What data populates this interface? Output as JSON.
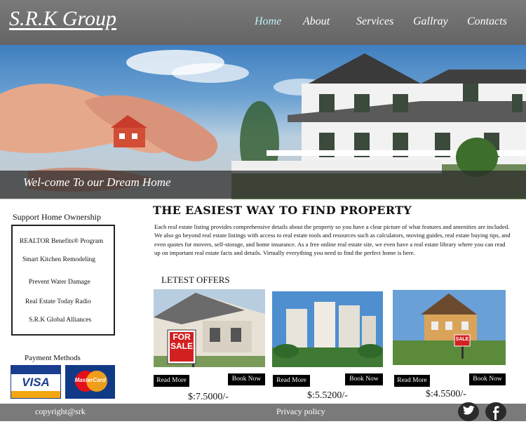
{
  "header": {
    "logo": "S.R.K Group",
    "nav": [
      "Home",
      "About",
      "Services",
      "Gallray",
      "Contacts"
    ],
    "active_index": 0
  },
  "hero": {
    "welcome": "Wel-come To our Dream Home"
  },
  "sidebar": {
    "title": "Support Home Ownership",
    "items": [
      "REALTOR Benefits® Program",
      "Smart Kitchen Remodeling",
      "Prevent Water Damage",
      "Real Estate Today Radio",
      "S.R.K Global Alliances"
    ],
    "payment_title": "Payment Methods",
    "payment_cards": [
      "VISA",
      "MasterCard"
    ]
  },
  "main": {
    "title": "THE EASIEST WAY TO FIND PROPERTY",
    "text": "Each real estate listing provides comprehensive details about the property so you have a clear picture of what features and amenities are included. We also go beyond real estate listings with access to real estate tools and resources such as calculators, moving guides, real estate buying tips, and even quotes for movers, self-storage, and home insurance. As a free online real estate site, we even have a real estate library where you can read up on important real estate facts and details. Virtually everything you need to find the perfect home is here.",
    "offers_title": "LETEST OFFERS",
    "offers": [
      {
        "sign": "FOR SALE",
        "read_more": "Read More",
        "book_now": "Book Now",
        "price": "$:7.5000/-"
      },
      {
        "read_more": "Read More",
        "book_now": "Book Now",
        "price": "$:5.5200/-"
      },
      {
        "sign": "SALE",
        "read_more": "Read More",
        "book_now": "Book Now",
        "price": "$:4.5500/-"
      }
    ]
  },
  "footer": {
    "copyright": "copyright@srk",
    "privacy": "Privacy policy",
    "social": [
      "twitter-icon",
      "facebook-icon"
    ]
  },
  "colors": {
    "header_bg": "#6d6d6d",
    "nav_active": "#bfeef0",
    "footer_bg": "#7a7a7a",
    "button_bg": "#000000"
  }
}
